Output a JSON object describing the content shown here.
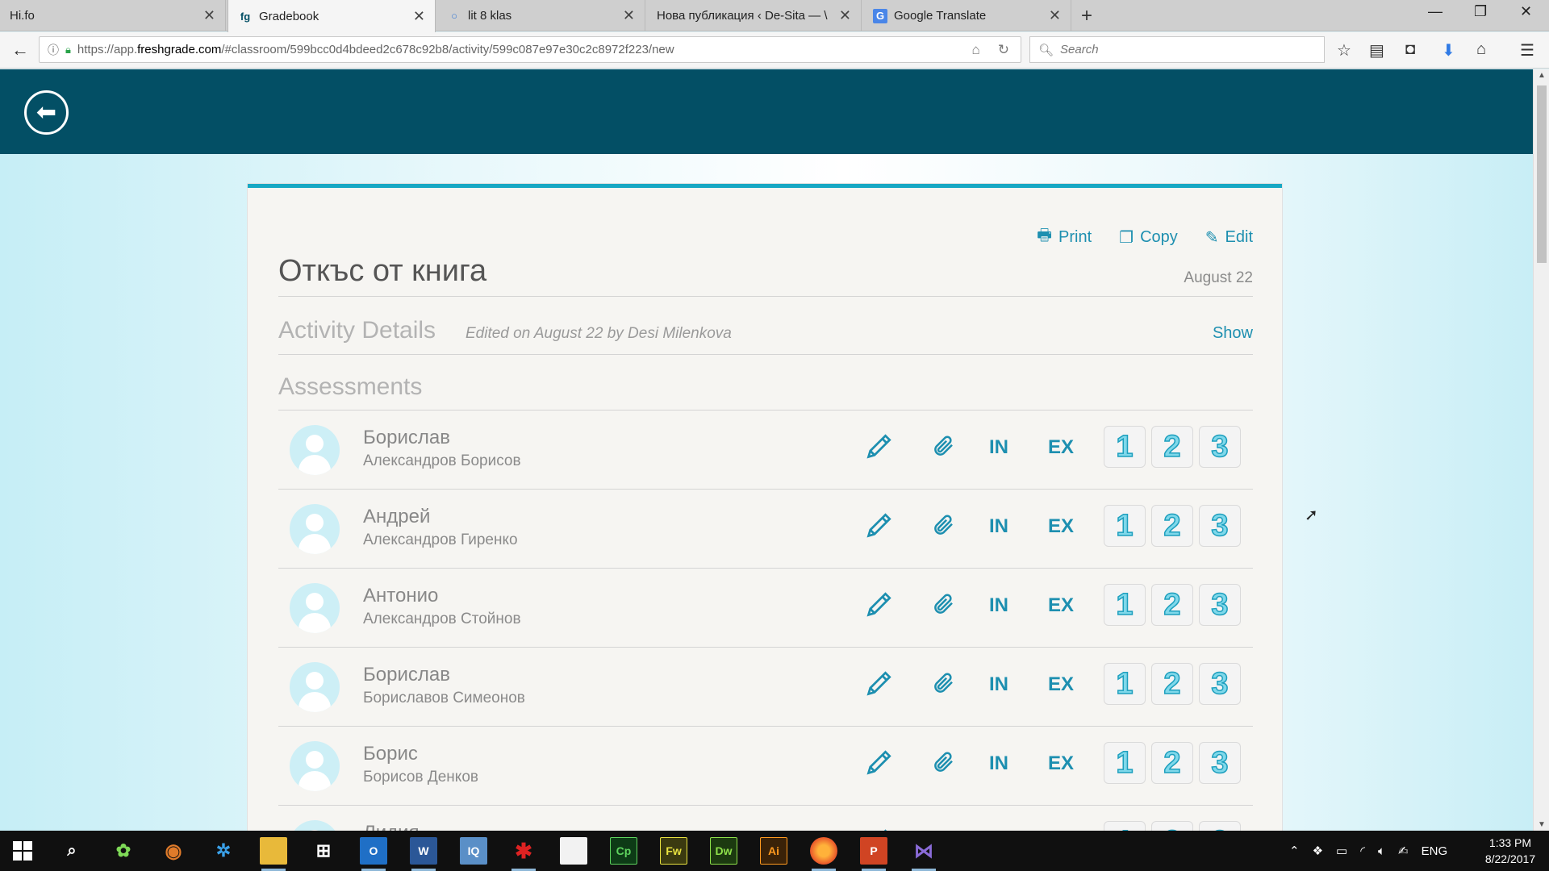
{
  "browser": {
    "tabs": [
      {
        "label": "Hi.fo",
        "icon": "",
        "active": false
      },
      {
        "label": "Gradebook",
        "icon": "fg",
        "active": true
      },
      {
        "label": "lit 8 klas",
        "icon": "○",
        "active": false
      },
      {
        "label": "Нова публикация ‹ De-Sita — \\",
        "icon": "",
        "active": false
      },
      {
        "label": "Google Translate",
        "icon": "G",
        "active": false
      }
    ],
    "url_prefix": "https://app.",
    "url_host": "freshgrade.com",
    "url_path": "/#classroom/599bcc0d4bdeed2c678c92b8/activity/599c087e97e30c2c8972f223/new",
    "search_placeholder": "Search"
  },
  "header": {
    "back_icon": "arrow-left-circle-icon",
    "color": "#034f65"
  },
  "activity": {
    "actions": {
      "print": "Print",
      "copy": "Copy",
      "edit": "Edit"
    },
    "title": "Откъс от книга",
    "date": "August 22",
    "details_title": "Activity Details",
    "edited_note": "Edited on August 22 by Desi Milenkova",
    "show_label": "Show",
    "assessments_title": "Assessments",
    "accent": "#1d8fb0"
  },
  "students": [
    {
      "first": "Борислав",
      "last": "Александров Борисов"
    },
    {
      "first": "Андрей",
      "last": "Александров Гиренко"
    },
    {
      "first": "Антонио",
      "last": "Александров Стойнов"
    },
    {
      "first": "Борислав",
      "last": "Бориславов Симеонов"
    },
    {
      "first": "Борис",
      "last": "Борисов Денков"
    },
    {
      "first": "Лидия",
      "last": ""
    }
  ],
  "assessment_tools": {
    "in": "IN",
    "ex": "EX",
    "levels": [
      "1",
      "2",
      "3"
    ]
  },
  "taskbar": {
    "apps": [
      "Cp",
      "Fw",
      "Dw",
      "Ai"
    ],
    "language": "ENG",
    "time": "1:33 PM",
    "date": "8/22/2017"
  }
}
